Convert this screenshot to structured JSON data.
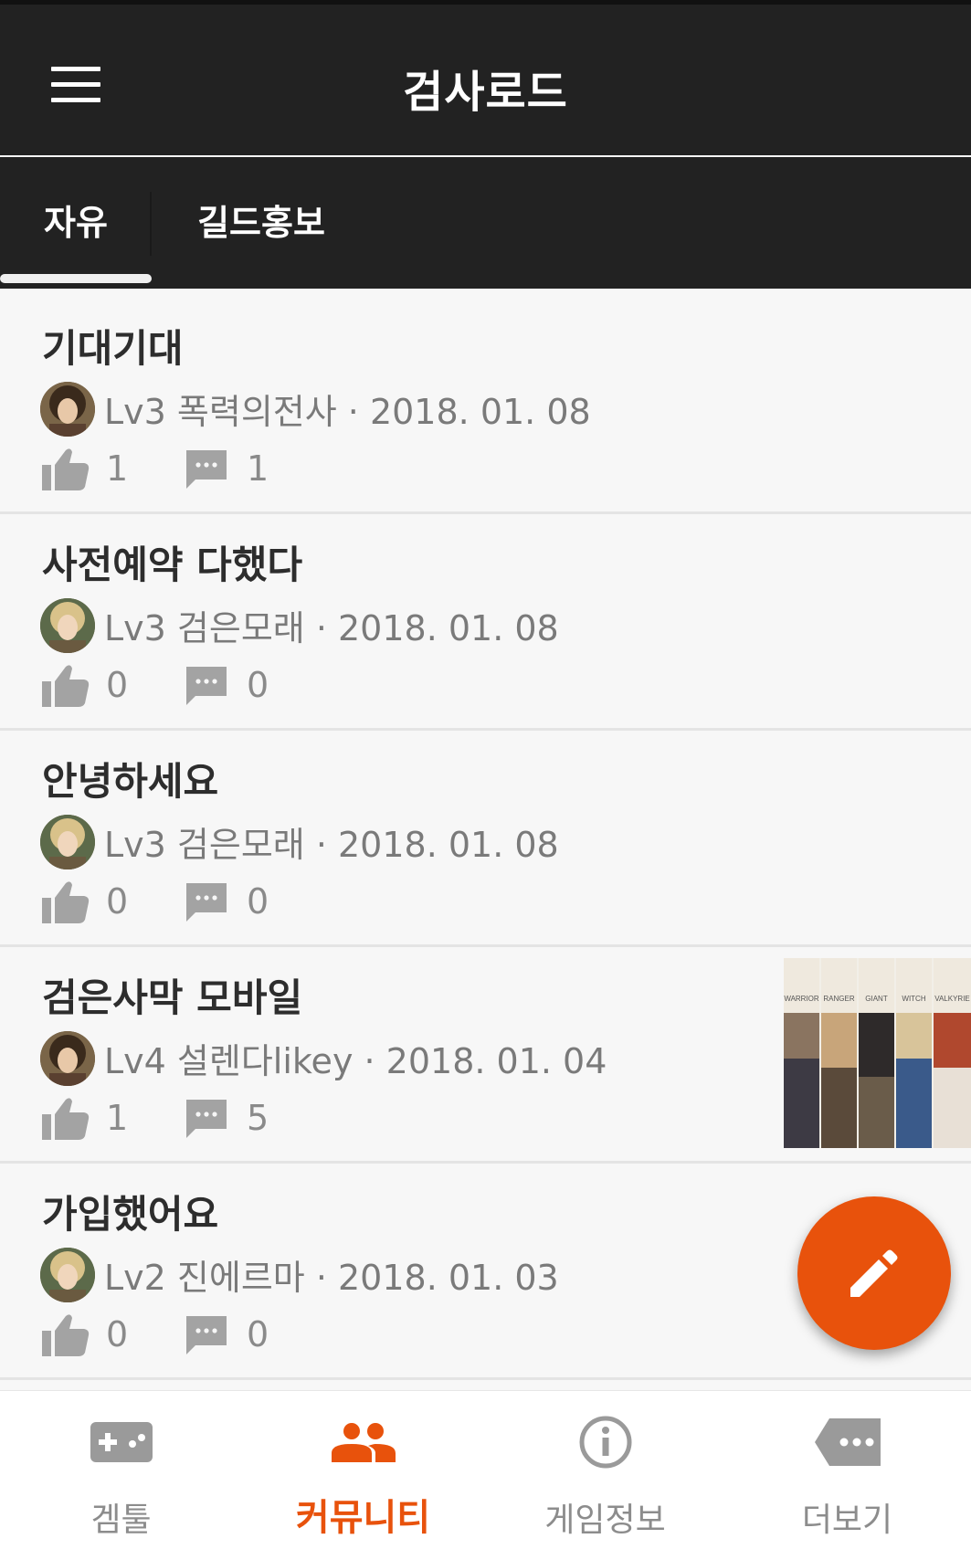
{
  "header": {
    "title": "검사로드",
    "menu_icon": "hamburger-menu-icon"
  },
  "tabs": [
    {
      "label": "자유",
      "active": true
    },
    {
      "label": "길드홍보",
      "active": false
    }
  ],
  "posts": [
    {
      "title": "기대기대",
      "meta": "Lv3 폭력의전사 · 2018. 01. 08",
      "likes": "1",
      "comments": "1",
      "has_thumbnail": false
    },
    {
      "title": "사전예약 다했다",
      "meta": "Lv3 검은모래 · 2018. 01. 08",
      "likes": "0",
      "comments": "0",
      "has_thumbnail": false
    },
    {
      "title": "안녕하세요",
      "meta": "Lv3 검은모래 · 2018. 01. 08",
      "likes": "0",
      "comments": "0",
      "has_thumbnail": false
    },
    {
      "title": "검은사막 모바일",
      "meta": "Lv4 설렌다likey · 2018. 01. 04",
      "likes": "1",
      "comments": "5",
      "has_thumbnail": true
    },
    {
      "title": "가입했어요",
      "meta": "Lv2 진에르마 · 2018. 01. 03",
      "likes": "0",
      "comments": "0",
      "has_thumbnail": false
    }
  ],
  "thumbnail": {
    "captions": [
      "WARRIOR",
      "RANGER",
      "GIANT",
      "WITCH",
      "VALKYRIE"
    ]
  },
  "fab": {
    "icon": "pencil-icon"
  },
  "bottom_nav": [
    {
      "label": "겜툴",
      "icon": "gamepad-icon",
      "active": false
    },
    {
      "label": "커뮤니티",
      "icon": "people-icon",
      "active": true
    },
    {
      "label": "게임정보",
      "icon": "info-icon",
      "active": false
    },
    {
      "label": "더보기",
      "icon": "more-icon",
      "active": false
    }
  ],
  "colors": {
    "header_bg": "#222222",
    "accent": "#e8520c",
    "icon_gray": "#9a9a9a",
    "text_dark": "#2d2d2d"
  }
}
